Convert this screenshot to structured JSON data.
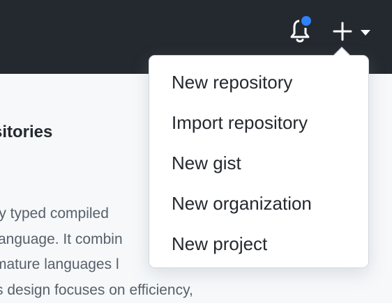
{
  "header": {
    "notifications_icon": "bell-icon",
    "notification_indicator_color": "#2f81f7",
    "create_icon": "plus-icon",
    "create_caret_icon": "triangle-down-icon",
    "background_color": "#24292f"
  },
  "create_menu": {
    "items": [
      {
        "label": "New repository"
      },
      {
        "label": "Import repository"
      },
      {
        "label": "New gist"
      },
      {
        "label": "New organization"
      },
      {
        "label": "New project"
      }
    ]
  },
  "background_page": {
    "section_heading": "sitories",
    "description_lines": [
      "lly typed compiled",
      "anguage. It combin",
      "mature languages l",
      "s design focuses on efficiency,"
    ]
  }
}
